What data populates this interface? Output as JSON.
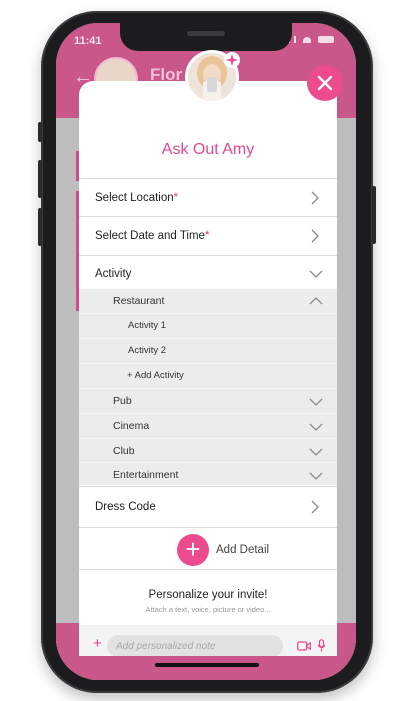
{
  "status_bar": {
    "time": "11:41"
  },
  "background_app": {
    "back_glyph": "←",
    "contact_name_partial": "Flor"
  },
  "modal": {
    "title": "Ask Out Amy",
    "location_label": "Select Location",
    "date_time_label": "Select Date and Time",
    "required_marker": "*",
    "activity_label": "Activity",
    "subcategories": {
      "restaurant": "Restaurant",
      "restaurant_items": [
        "Activity 1",
        "Activity 2"
      ],
      "add_activity": "+ Add Activity",
      "pub": "Pub",
      "cinema": "Cinema",
      "club": "Club",
      "entertainment": "Entertainment"
    },
    "dress_code_label": "Dress Code",
    "add_detail_label": "Add Detail",
    "add_detail_glyph": "+",
    "personalize_title": "Personalize your invite!",
    "personalize_subtitle": "Attach a text, voice, picture or video...",
    "note_plus_glyph": "+",
    "note_placeholder": "Add personalized note"
  },
  "icons": {
    "close": "close-icon",
    "chevron_right": "chevron-right-icon",
    "chevron_down": "chevron-down-icon",
    "chevron_up": "chevron-up-icon",
    "video": "video-camera-icon",
    "mic": "microphone-icon",
    "sparkle": "sparkle-badge-icon"
  },
  "colors": {
    "accent": "#ec4b8e",
    "title_pink": "#e6478e",
    "required_red": "#e23b6e",
    "header_bg": "#c9578a",
    "submenu_bg": "#ececec"
  }
}
